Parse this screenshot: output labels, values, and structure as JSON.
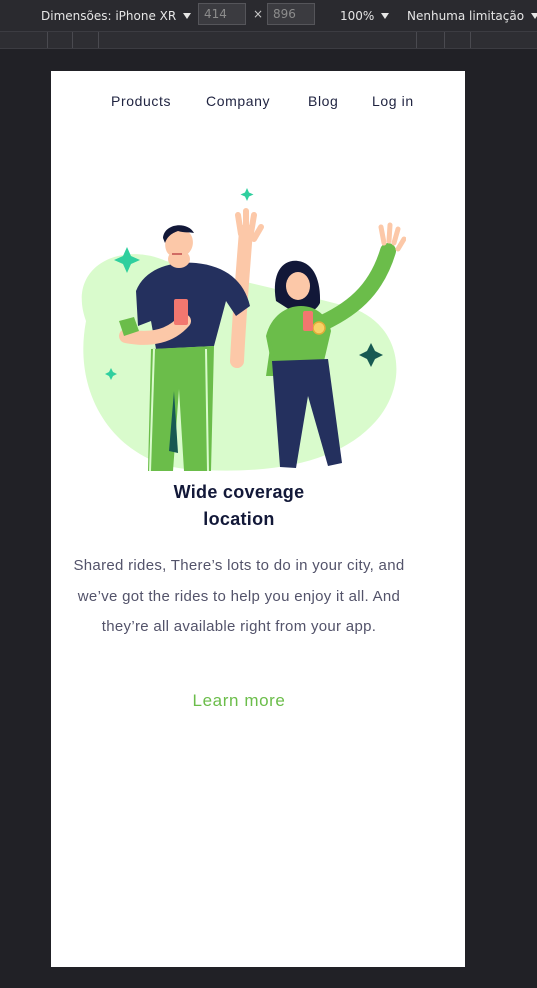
{
  "devtools": {
    "device_label": "Dimensões: iPhone XR",
    "width_value": "414",
    "height_value": "896",
    "times_symbol": "×",
    "zoom": "100%",
    "throttle": "Nenhuma limitação"
  },
  "nav": {
    "items": [
      {
        "label": "Products"
      },
      {
        "label": "Company"
      },
      {
        "label": "Blog"
      },
      {
        "label": "Log in"
      }
    ]
  },
  "hero": {
    "title_line1": "Wide coverage",
    "title_line2": "location",
    "description_lines": [
      "Shared rides, There’s lots to do in your city, and",
      "we’ve got the rides to help you enjoy it all. And",
      "they’re all available right from your app."
    ],
    "cta_label": "Learn more"
  },
  "colors": {
    "accent": "#6bbd4a",
    "heading": "#121838",
    "blob": "#d9fbcc",
    "sparkle_teal": "#2fcf9e",
    "sparkle_dark": "#175a52"
  }
}
